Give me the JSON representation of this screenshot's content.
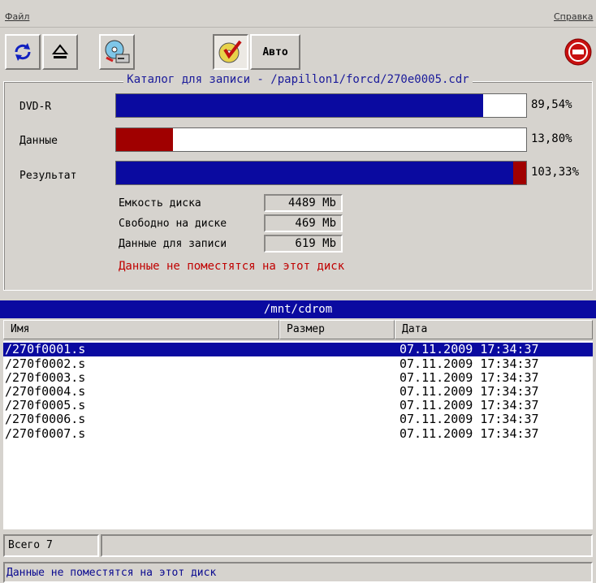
{
  "menubar": {
    "file_label": "Файл",
    "help_label": "Справка"
  },
  "toolbar": {
    "auto_label": "Авто"
  },
  "catalog": {
    "legend": "Каталог для записи - /papillon1/forcd/270e0005.cdr",
    "rows": [
      {
        "label": "DVD-R",
        "percent_text": "89,54%",
        "fill_fraction": 0.8954,
        "color": "#0a0aa0",
        "overflow_fraction": 0
      },
      {
        "label": "Данные",
        "percent_text": "13,80%",
        "fill_fraction": 0.138,
        "color": "#a00000",
        "overflow_fraction": 0
      },
      {
        "label": "Результат",
        "percent_text": "103,33%",
        "fill_fraction": 1.0,
        "color": "#0a0aa0",
        "overflow_fraction": 0.0333,
        "overflow_color": "#a00000"
      }
    ],
    "stats": [
      {
        "label": "Емкость диска",
        "value": "4489 Mb"
      },
      {
        "label": "Свободно на диске",
        "value": "469 Mb"
      },
      {
        "label": "Данные для записи",
        "value": "619 Mb"
      }
    ],
    "warning": "Данные не поместятся на этот диск"
  },
  "list": {
    "path": "/mnt/cdrom",
    "columns": {
      "name": "Имя",
      "size": "Размер",
      "date": "Дата"
    },
    "files": [
      {
        "name": "/270f0001.s",
        "size": "",
        "date": "07.11.2009 17:34:37",
        "selected": true
      },
      {
        "name": "/270f0002.s",
        "size": "",
        "date": "07.11.2009 17:34:37",
        "selected": false
      },
      {
        "name": "/270f0003.s",
        "size": "",
        "date": "07.11.2009 17:34:37",
        "selected": false
      },
      {
        "name": "/270f0004.s",
        "size": "",
        "date": "07.11.2009 17:34:37",
        "selected": false
      },
      {
        "name": "/270f0005.s",
        "size": "",
        "date": "07.11.2009 17:34:37",
        "selected": false
      },
      {
        "name": "/270f0006.s",
        "size": "",
        "date": "07.11.2009 17:34:37",
        "selected": false
      },
      {
        "name": "/270f0007.s",
        "size": "",
        "date": "07.11.2009 17:34:37",
        "selected": false
      }
    ]
  },
  "footer": {
    "count_text": "Всего 7",
    "status_text": "Данные не поместятся на этот диск"
  },
  "icons": [
    "refresh-icon",
    "eject-icon",
    "burner-settings-icon",
    "disc-verify-icon",
    "exit-icon"
  ]
}
